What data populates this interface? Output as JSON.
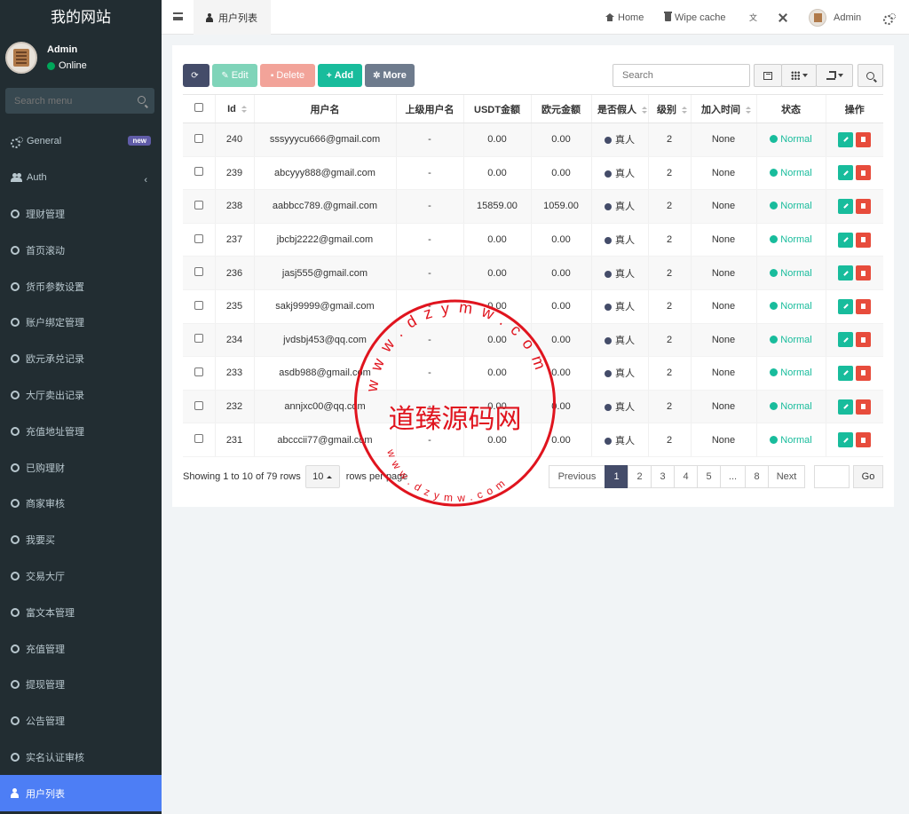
{
  "sidebar": {
    "logo": "我的网站",
    "user": {
      "name": "Admin",
      "status": "Online"
    },
    "search_placeholder": "Search menu",
    "items": [
      {
        "label": "General",
        "badge": "new"
      },
      {
        "label": "Auth"
      },
      {
        "label": "理财管理"
      },
      {
        "label": "首页滚动"
      },
      {
        "label": "货币参数设置"
      },
      {
        "label": "账户绑定管理"
      },
      {
        "label": "欧元承兑记录"
      },
      {
        "label": "大厅卖出记录"
      },
      {
        "label": "充值地址管理"
      },
      {
        "label": "已购理财"
      },
      {
        "label": "商家审核"
      },
      {
        "label": "我要买"
      },
      {
        "label": "交易大厅"
      },
      {
        "label": "富文本管理"
      },
      {
        "label": "充值管理"
      },
      {
        "label": "提现管理"
      },
      {
        "label": "公告管理"
      },
      {
        "label": "实名认证审核"
      },
      {
        "label": "用户列表"
      }
    ]
  },
  "header": {
    "tab": "用户列表",
    "home": "Home",
    "wipe_cache": "Wipe cache",
    "admin": "Admin"
  },
  "toolbar": {
    "edit": "Edit",
    "delete": "Delete",
    "add": "Add",
    "more": "More",
    "search_placeholder": "Search"
  },
  "table": {
    "headers": [
      "Id",
      "用户名",
      "上级用户名",
      "USDT金额",
      "欧元金额",
      "是否假人",
      "级别",
      "加入时间",
      "状态",
      "操作"
    ],
    "rows": [
      [
        "240",
        "sssyyycu666@gmail.com",
        "-",
        "0.00",
        "0.00",
        "真人",
        "2",
        "None",
        "Normal"
      ],
      [
        "239",
        "abcyyy888@gmail.com",
        "-",
        "0.00",
        "0.00",
        "真人",
        "2",
        "None",
        "Normal"
      ],
      [
        "238",
        "aabbcc789.@gmail.com",
        "-",
        "15859.00",
        "1059.00",
        "真人",
        "2",
        "None",
        "Normal"
      ],
      [
        "237",
        "jbcbj2222@gmail.com",
        "-",
        "0.00",
        "0.00",
        "真人",
        "2",
        "None",
        "Normal"
      ],
      [
        "236",
        "jasj555@gmail.com",
        "-",
        "0.00",
        "0.00",
        "真人",
        "2",
        "None",
        "Normal"
      ],
      [
        "235",
        "sakj99999@gmail.com",
        "-",
        "0.00",
        "0.00",
        "真人",
        "2",
        "None",
        "Normal"
      ],
      [
        "234",
        "jvdsbj453@qq.com",
        "-",
        "0.00",
        "0.00",
        "真人",
        "2",
        "None",
        "Normal"
      ],
      [
        "233",
        "asdb988@gmail.com",
        "-",
        "0.00",
        "0.00",
        "真人",
        "2",
        "None",
        "Normal"
      ],
      [
        "232",
        "annjxc00@qq.com",
        "-",
        "0.00",
        "0.00",
        "真人",
        "2",
        "None",
        "Normal"
      ],
      [
        "231",
        "abcccii77@gmail.com",
        "-",
        "0.00",
        "0.00",
        "真人",
        "2",
        "None",
        "Normal"
      ]
    ]
  },
  "pager": {
    "showing": "Showing 1 to 10 of 79 rows",
    "page_size": "10",
    "rows_per_page": "rows per page",
    "previous": "Previous",
    "pages": [
      "1",
      "2",
      "3",
      "4",
      "5",
      "...",
      "8"
    ],
    "next": "Next",
    "go": "Go"
  },
  "watermark": {
    "top_text": "www.dzymw.com",
    "center_text": "道臻源码网",
    "bottom_text": "www.dzymw.com"
  },
  "colors": {
    "sidebar_bg": "#222d32",
    "active_item": "#4d7ef5",
    "primary_dark": "#444c69",
    "success": "#18bc9c",
    "danger": "#e74c3c",
    "stamp_red": "#e0141e"
  }
}
